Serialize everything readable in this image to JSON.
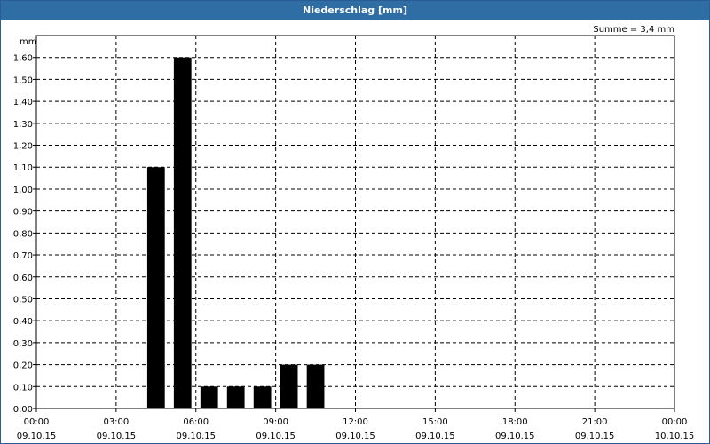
{
  "window": {
    "title": "Niederschlag [mm]"
  },
  "chart_data": {
    "type": "bar",
    "title": "Niederschlag [mm]",
    "ylabel": "mm",
    "summary": "Summe = 3,4 mm",
    "ylim": [
      0,
      1.7
    ],
    "y_ticks": [
      "0,00",
      "0,10",
      "0,20",
      "0,30",
      "0,40",
      "0,50",
      "0,60",
      "0,70",
      "0,80",
      "0,90",
      "1,00",
      "1,10",
      "1,20",
      "1,30",
      "1,40",
      "1,50",
      "1,60"
    ],
    "x_range_hours": [
      0,
      24
    ],
    "x_ticks": [
      {
        "time": "00:00",
        "date": "09.10.15"
      },
      {
        "time": "03:00",
        "date": "09.10.15"
      },
      {
        "time": "06:00",
        "date": "09.10.15"
      },
      {
        "time": "09:00",
        "date": "09.10.15"
      },
      {
        "time": "12:00",
        "date": "09.10.15"
      },
      {
        "time": "15:00",
        "date": "09.10.15"
      },
      {
        "time": "18:00",
        "date": "09.10.15"
      },
      {
        "time": "21:00",
        "date": "09.10.15"
      },
      {
        "time": "00:00",
        "date": "10.10.15"
      }
    ],
    "bars": [
      {
        "start": "04:00",
        "end": "05:00",
        "value": 1.1
      },
      {
        "start": "05:00",
        "end": "06:00",
        "value": 1.6
      },
      {
        "start": "06:00",
        "end": "07:00",
        "value": 0.1
      },
      {
        "start": "07:00",
        "end": "08:00",
        "value": 0.1
      },
      {
        "start": "08:00",
        "end": "09:00",
        "value": 0.1
      },
      {
        "start": "09:00",
        "end": "10:00",
        "value": 0.2
      },
      {
        "start": "10:00",
        "end": "11:00",
        "value": 0.2
      }
    ],
    "bar_color": "#000000",
    "grid": true
  }
}
